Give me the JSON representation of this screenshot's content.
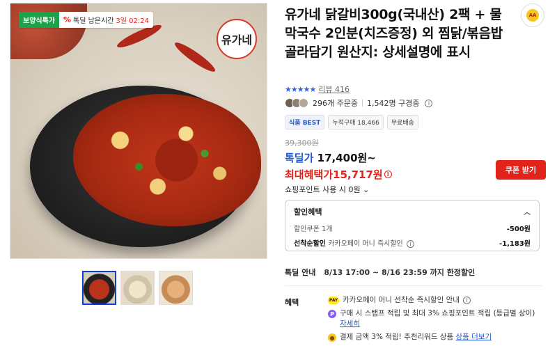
{
  "product": {
    "title": "유가네 닭갈비300g(국내산) 2팩 + 물막국수 2인분(치즈증정) 외 찜닭/볶음밥 골라담기 원산지: 상세설명에 표시",
    "badge_sale": "보양식특가",
    "timer_label": "톡딜 남은시간",
    "timer_value": "3일 02:24",
    "logo_text": "유가네"
  },
  "rating": {
    "stars": "★★★★★",
    "review_label": "리뷰 416"
  },
  "orders": {
    "order_count": "296개 주문중",
    "subscriber_count": "1,542명 구경중"
  },
  "tags": {
    "best": "식품 BEST",
    "cumulative": "누적구매 18,466",
    "shipping": "무료배송"
  },
  "price": {
    "original": "39,300원",
    "deal_label": "톡딜가",
    "deal_price": "17,400원~",
    "max_label": "최대혜택가",
    "max_price": "15,717원",
    "coupon_button": "쿠폰 받기",
    "point_usage": "쇼핑포인트 사용 시 0원"
  },
  "discount": {
    "header": "할인혜택",
    "rows": [
      {
        "label": "할인쿠폰 1개",
        "amount": "-500원"
      },
      {
        "label_bold": "선착순할인",
        "label": "카카오페이 머니 즉시할인",
        "amount": "-1,183원"
      }
    ]
  },
  "deal_info": {
    "label": "톡딜 안내",
    "text": "8/13 17:00 ~ 8/16 23:59 까지 한정할인"
  },
  "benefits": {
    "label": "혜택",
    "items": [
      {
        "icon": "kakaopay-icon",
        "text": "카카오페이 머니 선착순 즉시할인 안내"
      },
      {
        "icon": "point-icon",
        "text": "구매 시 스탬프 적립 및 최대 3% 쇼핑포인트 적립 (등급별 상이)",
        "link": "자세히"
      },
      {
        "icon": "coin-icon",
        "text": "결제 금액 3% 적립! 추천리워드 상품",
        "link": "상품 더보기"
      }
    ]
  },
  "colors": {
    "accent_blue": "#1f5bd6",
    "accent_red": "#e2231a",
    "badge_green": "#1aa34a"
  }
}
